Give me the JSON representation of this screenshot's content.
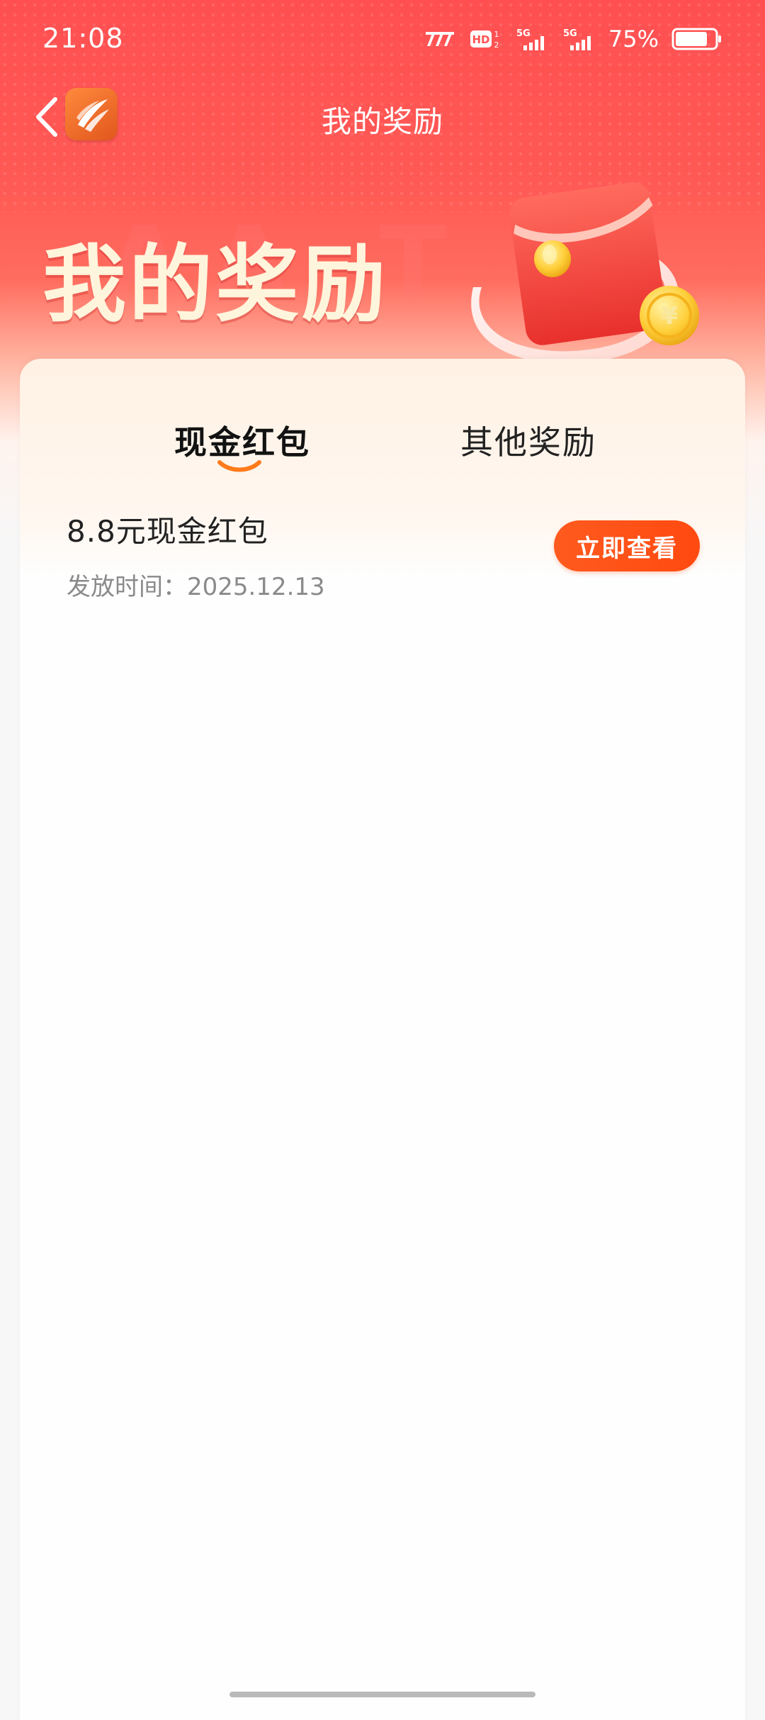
{
  "status_bar": {
    "time": "21:08",
    "battery_percent": "75%",
    "battery_level": 0.75,
    "signal_label_1": "5G",
    "signal_label_2": "5G",
    "hd_label": "HD"
  },
  "nav": {
    "title": "我的奖励"
  },
  "hero": {
    "title": "我的奖励"
  },
  "tabs": [
    {
      "label": "现金红包",
      "active": true
    },
    {
      "label": "其他奖励",
      "active": false
    }
  ],
  "rewards": [
    {
      "title": "8.8元现金红包",
      "date_label": "发放时间：",
      "date": "2025.12.13",
      "action_label": "立即查看"
    }
  ],
  "colors": {
    "header_red": "#ff4f51",
    "accent_orange": "#ff5a1f",
    "tab_indicator": "#ff7a1a"
  }
}
